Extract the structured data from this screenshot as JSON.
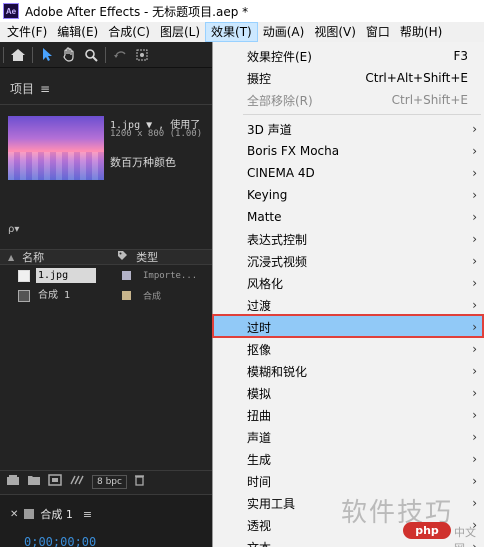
{
  "window": {
    "icon_text": "Ae",
    "title": "Adobe After Effects - 无标题项目.aep *"
  },
  "menubar": [
    {
      "label": "文件(F)"
    },
    {
      "label": "编辑(E)"
    },
    {
      "label": "合成(C)"
    },
    {
      "label": "图层(L)"
    },
    {
      "label": "效果(T)",
      "active": true
    },
    {
      "label": "动画(A)"
    },
    {
      "label": "视图(V)"
    },
    {
      "label": "窗口"
    },
    {
      "label": "帮助(H)"
    }
  ],
  "toolbar": {
    "icons": [
      "home-icon",
      "selection-tool-icon",
      "hand-tool-icon",
      "zoom-tool-icon",
      "rotate-tool-icon",
      "camera-tool-icon"
    ]
  },
  "project_panel": {
    "title": "项目",
    "menu_glyph": "≡",
    "asset": {
      "name_line": "1.jpg ▼ , 使用了",
      "dimensions": "1200 x 800 (1.00)",
      "colors": "数百万种颜色"
    },
    "search": {
      "icon": "ρ▾",
      "placeholder": ""
    },
    "columns": {
      "name": "名称",
      "type": "类型"
    },
    "rows": [
      {
        "name": "1.jpg",
        "type": "Importe...",
        "selected": true
      },
      {
        "name": "合成 1",
        "type": "合成",
        "selected": false
      }
    ],
    "bpc": "8 bpc"
  },
  "timeline": {
    "tab_title": "合成 1",
    "menu_glyph": "≡",
    "timecode": "0;00;00;00"
  },
  "effects_menu": {
    "items": [
      {
        "label": "效果控件(E)",
        "shortcut": "F3"
      },
      {
        "label": "摄控",
        "shortcut": "Ctrl+Alt+Shift+E"
      },
      {
        "label": "全部移除(R)",
        "shortcut": "Ctrl+Shift+E",
        "disabled": true
      },
      {
        "label": "3D 声道",
        "submenu": true
      },
      {
        "label": "Boris FX Mocha",
        "submenu": true
      },
      {
        "label": "CINEMA 4D",
        "submenu": true
      },
      {
        "label": "Keying",
        "submenu": true
      },
      {
        "label": "Matte",
        "submenu": true
      },
      {
        "label": "表达式控制",
        "submenu": true
      },
      {
        "label": "沉浸式视频",
        "submenu": true
      },
      {
        "label": "风格化",
        "submenu": true
      },
      {
        "label": "过渡",
        "submenu": true
      },
      {
        "label": "过时",
        "submenu": true,
        "highlighted": true
      },
      {
        "label": "抠像",
        "submenu": true
      },
      {
        "label": "模糊和锐化",
        "submenu": true
      },
      {
        "label": "模拟",
        "submenu": true
      },
      {
        "label": "扭曲",
        "submenu": true
      },
      {
        "label": "声道",
        "submenu": true
      },
      {
        "label": "生成",
        "submenu": true
      },
      {
        "label": "时间",
        "submenu": true
      },
      {
        "label": "实用工具",
        "submenu": true
      },
      {
        "label": "透视",
        "submenu": true
      },
      {
        "label": "文本",
        "submenu": true
      }
    ]
  },
  "watermark": {
    "text": "软件技巧",
    "logo": "php",
    "site": "中文网"
  }
}
